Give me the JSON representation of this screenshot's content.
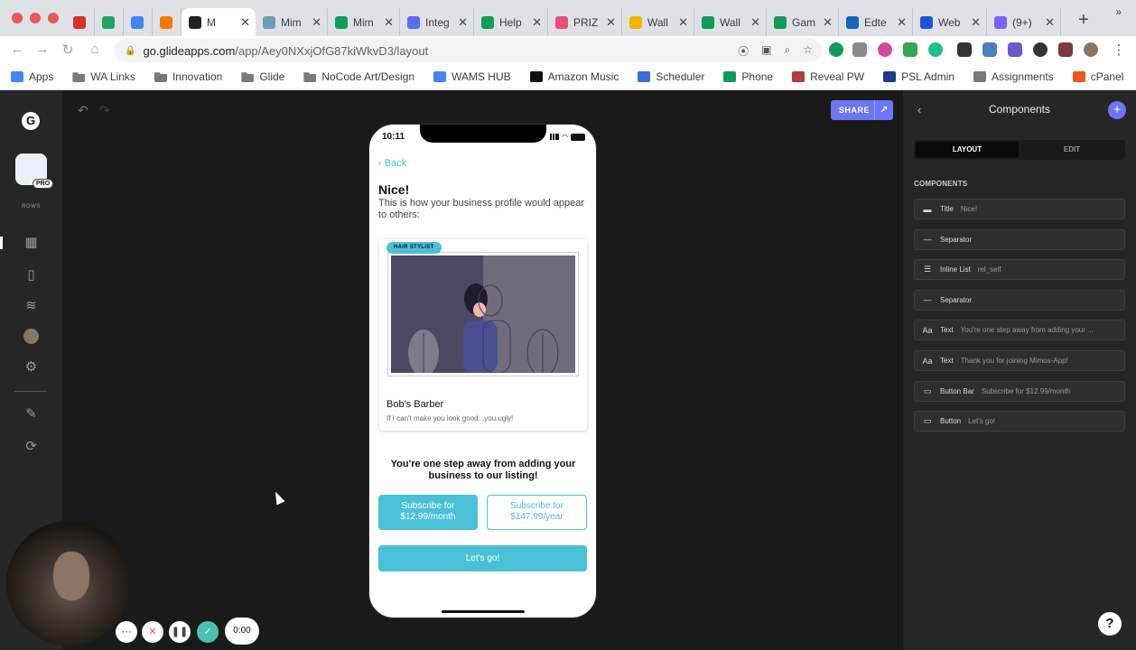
{
  "browser": {
    "tabs": [
      {
        "label": "",
        "color": "#d93025"
      },
      {
        "label": "",
        "color": "#1fa463"
      },
      {
        "label": "",
        "color": "#4285f4"
      },
      {
        "label": "",
        "color": "#f57c00"
      },
      {
        "label": "M",
        "color": "#202124"
      },
      {
        "label": "Mim",
        "color": "#6a9fb5"
      },
      {
        "label": "Mim",
        "color": "#0f9d58"
      },
      {
        "label": "Integ",
        "color": "#5b6df0"
      },
      {
        "label": "Help",
        "color": "#0f9d58"
      },
      {
        "label": "PRIZ",
        "color": "#e94e77"
      },
      {
        "label": "Wall",
        "color": "#f4b400"
      },
      {
        "label": "Wall",
        "color": "#0f9d58"
      },
      {
        "label": "Gam",
        "color": "#0f9d58"
      },
      {
        "label": "Edte",
        "color": "#1565c0"
      },
      {
        "label": "Web",
        "color": "#1a56db"
      },
      {
        "label": "(9+)",
        "color": "#7b61ff"
      }
    ],
    "url_host": "go.glideapps.com",
    "url_path": "/app/Aey0NXxjOfG87kiWkvD3/layout",
    "bookmarks": [
      {
        "label": "Apps",
        "icon": "apps-grid-icon"
      },
      {
        "label": "WA Links",
        "icon": "folder-icon"
      },
      {
        "label": "Innovation",
        "icon": "folder-icon"
      },
      {
        "label": "Glide",
        "icon": "folder-icon"
      },
      {
        "label": "NoCode Art/Design",
        "icon": "folder-icon"
      },
      {
        "label": "WAMS HUB",
        "icon": "doc-icon"
      },
      {
        "label": "Amazon Music",
        "icon": "amazon-icon"
      },
      {
        "label": "Scheduler",
        "icon": "calendar-icon"
      },
      {
        "label": "Phone",
        "icon": "sheets-icon"
      },
      {
        "label": "Reveal PW",
        "icon": "globe-icon"
      },
      {
        "label": "PSL Admin",
        "icon": "psl-icon"
      },
      {
        "label": "Assignments",
        "icon": "gear-icon"
      },
      {
        "label": "cPanel",
        "icon": "cpanel-icon"
      }
    ],
    "bookmarks_more": "»"
  },
  "rail": {
    "logo": "G",
    "pro_badge": "PRO",
    "rows_label": "ROWS"
  },
  "canvas": {
    "share_label": "SHARE"
  },
  "phone": {
    "time": "10:11",
    "back_label": "Back",
    "title": "Nice!",
    "subtitle": "This is how your business profile would appear to others:",
    "card_tag": "HAIR STYLIST",
    "card_name": "Bob's Barber",
    "card_desc": "If I can't make you look good...you ugly!",
    "pitch": "You're one step away from adding your business to our listing!",
    "sub_monthly": "Subscribe for $12.99/month",
    "sub_yearly": "Subscribe for $147.99/year",
    "cta": "Let's go!"
  },
  "panel": {
    "title": "Components",
    "tab_layout": "LAYOUT",
    "tab_edit": "EDIT",
    "section": "COMPONENTS",
    "components": [
      {
        "type": "Title",
        "value": "Nice!",
        "icon": "title-icon"
      },
      {
        "type": "Separator",
        "value": "",
        "icon": "separator-icon"
      },
      {
        "type": "Inline List",
        "value": "rel_self",
        "icon": "list-icon"
      },
      {
        "type": "Separator",
        "value": "",
        "icon": "separator-icon"
      },
      {
        "type": "Text",
        "value": "You're one step away from adding your ...",
        "icon": "text-icon"
      },
      {
        "type": "Text",
        "value": "Thank you for joining Mimos-App!",
        "icon": "text-icon"
      },
      {
        "type": "Button Bar",
        "value": "Subscribe for $12.99/month",
        "icon": "button-bar-icon"
      },
      {
        "type": "Button",
        "value": "Let's go!",
        "icon": "button-icon"
      }
    ]
  },
  "recorder": {
    "timer": "0:00"
  },
  "help_label": "?",
  "accent": "#4ac0d6",
  "brand": "#6a76f5"
}
